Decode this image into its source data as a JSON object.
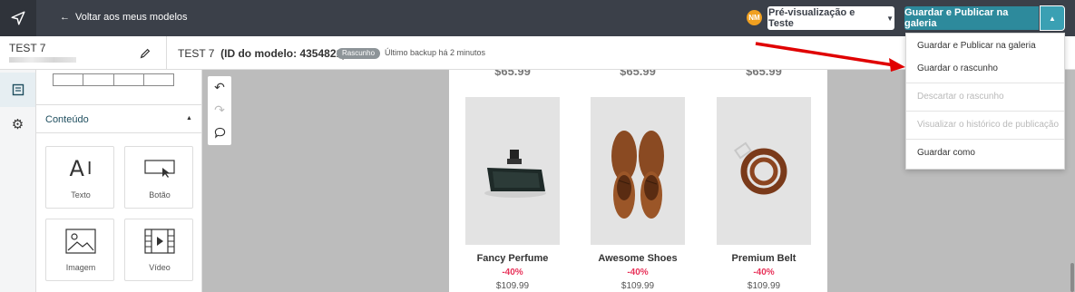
{
  "topbar": {
    "back_label": "Voltar aos meus modelos",
    "avatar_initials": "NM",
    "preview_label": "Pré-visualização e Teste",
    "publish_label": "Guardar e Publicar na galeria"
  },
  "subbar": {
    "template_name": "TEST 7",
    "title_name": "TEST 7",
    "title_id": "(ID do modelo: 4354821)",
    "status_badge": "Rascunho",
    "backup_note": "Último backup há 2 minutos"
  },
  "panel": {
    "section_title": "Conteúdo",
    "tiles": [
      {
        "label": "Texto",
        "icon": "text-icon"
      },
      {
        "label": "Botão",
        "icon": "button-icon"
      },
      {
        "label": "Imagem",
        "icon": "image-icon"
      },
      {
        "label": "Vídeo",
        "icon": "video-icon"
      }
    ]
  },
  "tools": [
    "undo-icon",
    "redo-icon",
    "comment-icon"
  ],
  "email": {
    "top_prices": [
      "$65.99",
      "$65.99",
      "$65.99"
    ],
    "products": [
      {
        "name": "Fancy Perfume",
        "discount": "-40%",
        "price": "$109.99",
        "image": "perfume-image"
      },
      {
        "name": "Awesome Shoes",
        "discount": "-40%",
        "price": "$109.99",
        "image": "shoes-image"
      },
      {
        "name": "Premium Belt",
        "discount": "-40%",
        "price": "$109.99",
        "image": "belt-image"
      }
    ]
  },
  "dropdown": {
    "items": [
      {
        "label": "Guardar e Publicar na galeria",
        "disabled": false
      },
      {
        "label": "Guardar o rascunho",
        "disabled": false
      },
      {
        "label": "Descartar o rascunho",
        "disabled": true
      },
      {
        "label": "Visualizar o histórico de publicação",
        "disabled": true
      },
      {
        "label": "Guardar como",
        "disabled": false
      }
    ]
  },
  "colors": {
    "topbar": "#3b4049",
    "accent": "#2d8a9c",
    "discount": "#e8335a",
    "annotation_arrow": "#e00000"
  }
}
